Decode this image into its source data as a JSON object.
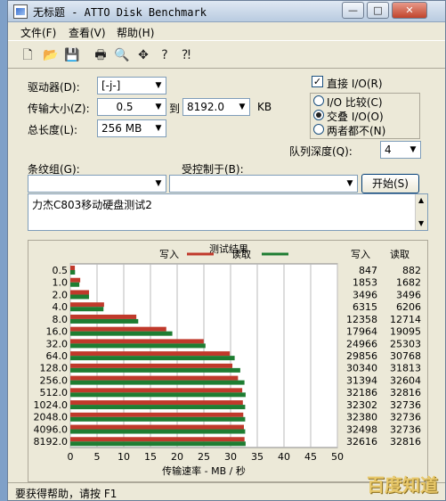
{
  "window": {
    "title": "无标题 - ATTO Disk Benchmark",
    "buttons": {
      "minimize": "—",
      "maximize": "□",
      "close": "✕"
    }
  },
  "menu": [
    "文件(F)",
    "查看(V)",
    "帮助(H)"
  ],
  "toolbar": [
    {
      "name": "new-icon",
      "glyph": "🗋"
    },
    {
      "name": "open-icon",
      "glyph": "📂"
    },
    {
      "name": "save-icon",
      "glyph": "💾"
    },
    {
      "name": "print-icon",
      "glyph": "🖶"
    },
    {
      "name": "print-preview-icon",
      "glyph": "🔍"
    },
    {
      "name": "move-icon",
      "glyph": "✥"
    },
    {
      "name": "help-icon",
      "glyph": "?"
    },
    {
      "name": "context-help-icon",
      "glyph": "⁈"
    }
  ],
  "form": {
    "drive_label": "驱动器(D):",
    "drive_value": "[-j-]",
    "transfer_label": "传输大小(Z):",
    "transfer_from": "0.5",
    "to_label": "到",
    "transfer_to": "8192.0",
    "kb_label": "KB",
    "total_label": "总长度(L):",
    "total_value": "256 MB",
    "direct_io_label": "直接 I/O(R)",
    "direct_io_checked": true,
    "radio_compare": "I/O 比较(C)",
    "radio_overlap": "交叠 I/O(O)",
    "radio_neither": "两者都不(N)",
    "queue_label": "队列深度(Q):",
    "queue_value": "4",
    "control_group_label": "条纹组(G):",
    "controlled_by_label": "受控制于(B):",
    "start_button": "开始(S)",
    "description": "力杰C803移动硬盘测试2"
  },
  "chart_data": {
    "type": "bar",
    "title": "测试结果",
    "legend": {
      "write": "写入",
      "read": "读取"
    },
    "colors": {
      "write": "#c0392b",
      "read": "#1e7d32"
    },
    "categories": [
      "0.5",
      "1.0",
      "2.0",
      "4.0",
      "8.0",
      "16.0",
      "32.0",
      "64.0",
      "128.0",
      "256.0",
      "512.0",
      "1024.0",
      "2048.0",
      "4096.0",
      "8192.0"
    ],
    "series": [
      {
        "name": "写入",
        "values": [
          847,
          1853,
          3496,
          6315,
          12358,
          17964,
          24966,
          29856,
          30340,
          31394,
          32186,
          32302,
          32380,
          32498,
          32616
        ]
      },
      {
        "name": "读取",
        "values": [
          882,
          1682,
          3496,
          6206,
          12714,
          19095,
          25303,
          30768,
          31813,
          32604,
          32816,
          32736,
          32736,
          32736,
          32816
        ]
      }
    ],
    "column_headers": {
      "write": "写入",
      "read": "读取"
    },
    "xlabel": "传输速率 - MB / 秒",
    "xticks": [
      "0",
      "5",
      "10",
      "15",
      "20",
      "25",
      "30",
      "35",
      "40",
      "45",
      "50"
    ],
    "xlim": [
      0,
      50
    ],
    "unit_divisor": 1000
  },
  "status": "要获得帮助，请按 F1",
  "watermark": "百度知道"
}
